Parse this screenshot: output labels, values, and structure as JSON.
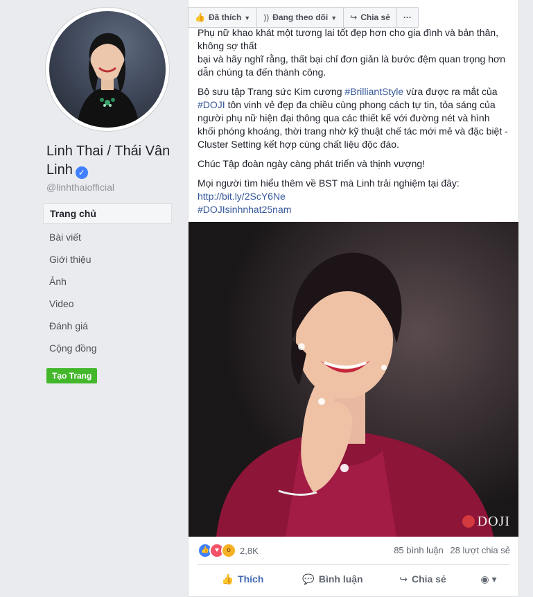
{
  "sidebar": {
    "page_name": "Linh Thai / Thái Vân Linh",
    "handle": "@linhthaiofficial",
    "nav": [
      "Trang chủ",
      "Bài viết",
      "Giới thiệu",
      "Ảnh",
      "Video",
      "Đánh giá",
      "Cộng đồng"
    ],
    "create_page": "Tạo Trang"
  },
  "toolbar": {
    "liked": "Đã thích",
    "following": "Đang theo dõi",
    "share": "Chia sẻ",
    "more": "···"
  },
  "post": {
    "p1a": "Phụ nữ khao khát một tương lai tốt đẹp hơn cho gia đình và bản thân, không sợ thất",
    "p1b": "bại và hãy nghĩ rằng, thất bại chỉ đơn giản là bước đệm quan trọng hơn dẫn chúng ta đến thành công.",
    "p2_pre": "Bộ sưu tập Trang sức Kim cương ",
    "p2_tag1": "#BrilliantStyle",
    "p2_mid": " vừa được ra mắt của ",
    "p2_tag2": "#DOJI",
    "p2_post": " tôn vinh vẻ đẹp đa chiều cùng phong cách tự tin, tỏa sáng của người phụ nữ hiện đại thông qua các thiết kế với đường nét và hình khối phóng khoáng, thời trang nhờ kỹ thuật chế tác mới mẻ và đặc biệt - Cluster Setting kết hợp cùng chất liệu độc đáo.",
    "p3": "Chúc Tập đoàn ngày càng phát triển và thịnh vượng!",
    "p4": "Mọi người tìm hiểu thêm về BST mà Linh trải nghiệm tại đây:",
    "link": "http://bit.ly/2ScY6Ne",
    "hashtag": "#DOJIsinhnhat25nam",
    "photo_watermark": "DOJI"
  },
  "reactions": {
    "count": "2,8K",
    "comments": "85 bình luận",
    "shares": "28 lượt chia sẻ"
  },
  "actions": {
    "like": "Thích",
    "comment": "Bình luận",
    "share": "Chia sẻ"
  },
  "colors": {
    "accent": "#4267b2",
    "link": "#365899",
    "create_button": "#42b72a",
    "background": "#e9ebee"
  }
}
